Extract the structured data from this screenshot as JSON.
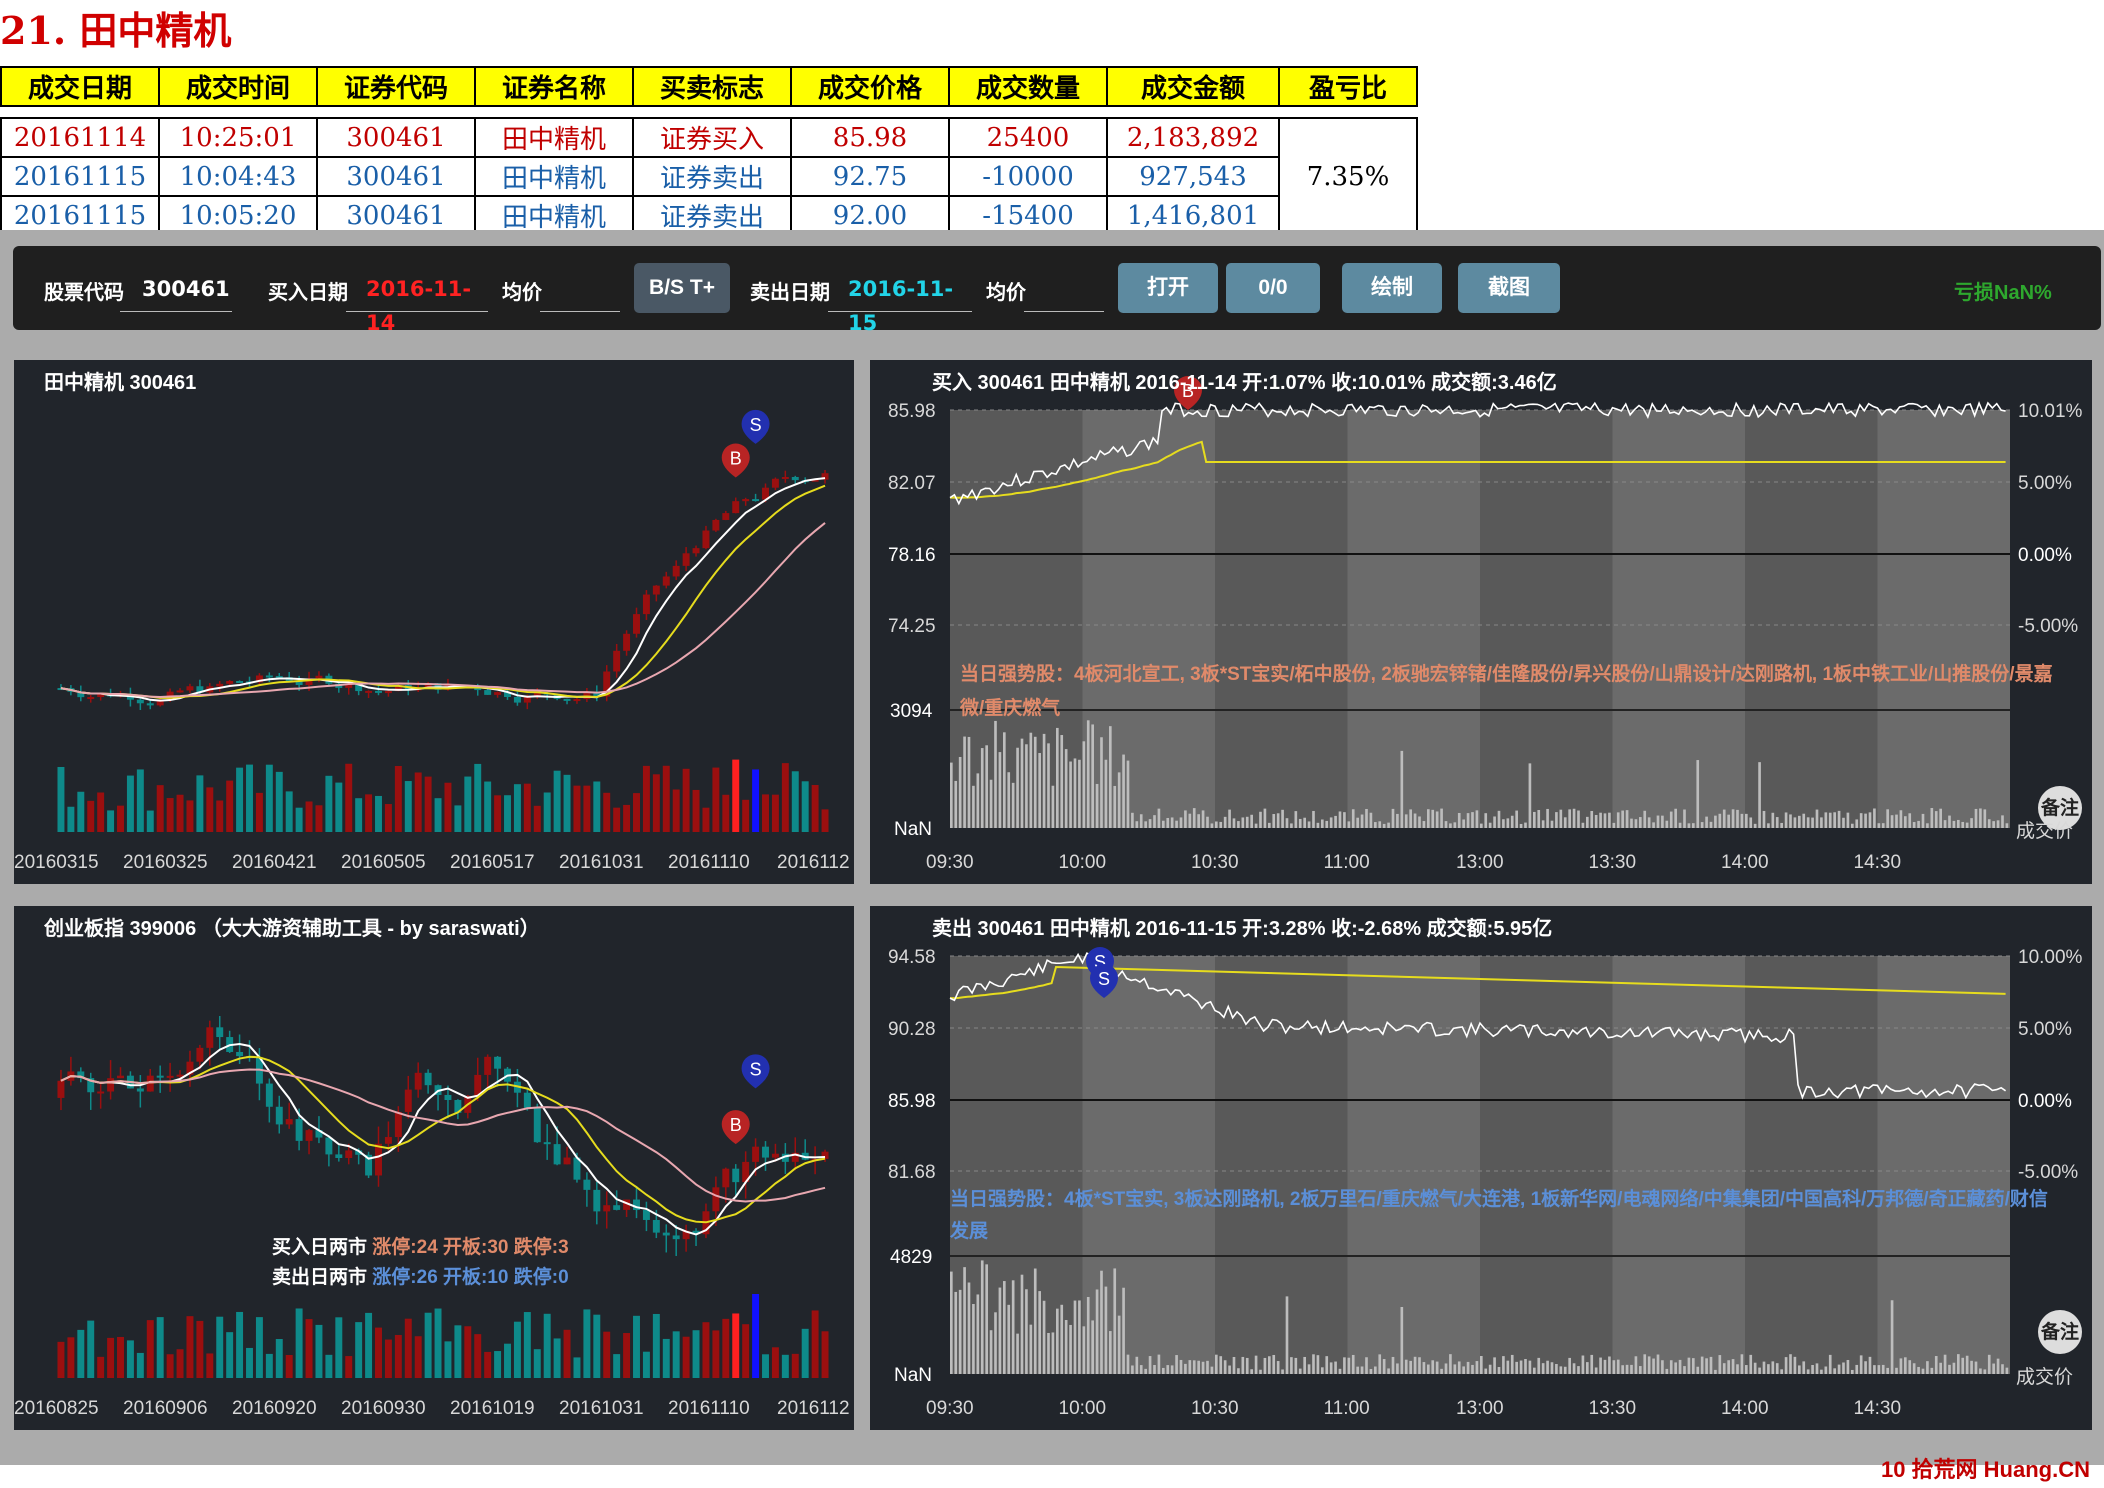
{
  "header": {
    "title": "21. 田中精机"
  },
  "trades_table": {
    "columns": [
      "成交日期",
      "成交时间",
      "证券代码",
      "证券名称",
      "买卖标志",
      "成交价格",
      "成交数量",
      "成交金额",
      "盈亏比"
    ],
    "rows": [
      [
        "20161114",
        "10:25:01",
        "300461",
        "田中精机",
        "证券买入",
        "85.98",
        "25400",
        "2,183,892"
      ],
      [
        "20161115",
        "10:04:43",
        "300461",
        "田中精机",
        "证券卖出",
        "92.75",
        "-10000",
        "927,543"
      ],
      [
        "20161115",
        "10:05:20",
        "300461",
        "田中精机",
        "证券卖出",
        "92.00",
        "-15400",
        "1,416,801"
      ]
    ],
    "pnl_ratio": "7.35%"
  },
  "toolbar": {
    "code_label": "股票代码",
    "code_value": "300461",
    "buy_date_label": "买入日期",
    "buy_date_value": "2016-11-14",
    "avg_label_1": "均价",
    "bs_button": "B/S T+",
    "sell_date_label": "卖出日期",
    "sell_date_value": "2016-11-15",
    "avg_label_2": "均价",
    "open_button": "打开",
    "counter_button": "0/0",
    "draw_button": "绘制",
    "screenshot_button": "截图",
    "status": "亏损NaN%"
  },
  "panels": {
    "stock_daily": {
      "title": "田中精机 300461",
      "dates": [
        "20160315",
        "20160325",
        "20160421",
        "20160505",
        "20160517",
        "20161031",
        "20161110",
        "2016112"
      ]
    },
    "index_daily": {
      "title": "创业板指 399006 （大大游资辅助工具 - by saraswati）",
      "dates": [
        "20160825",
        "20160906",
        "20160920",
        "20160930",
        "20161019",
        "20161031",
        "20161110",
        "2016112"
      ],
      "buy_market_label": "买入日两市",
      "buy_market_stats": "涨停:24 开板:30 跌停:3",
      "sell_market_label": "卖出日两市",
      "sell_market_stats": "涨停:26 开板:10 跌停:0"
    },
    "buy_intraday": {
      "title": "买入 300461 田中精机 2016-11-14 开:1.07% 收:10.01% 成交额:3.46亿",
      "price_ticks": [
        "85.98",
        "82.07",
        "78.16",
        "74.25"
      ],
      "pct_ticks": [
        "10.01%",
        "5.00%",
        "0.00%",
        "-5.00%"
      ],
      "vol_ticks": [
        "3094",
        "NaN"
      ],
      "times": [
        "09:30",
        "10:00",
        "10:30",
        "11:00",
        "13:00",
        "13:30",
        "14:00",
        "14:30"
      ],
      "strong": "当日强势股：4板河北宣工, 3板*ST宝实/柘中股份, 2板驰宏锌锗/佳隆股份/昇兴股份/山鼎设计/达刚路机, 1板中铁工业/山推股份/景嘉微/重庆燃气",
      "note_button": "备注",
      "price_label": "成交价"
    },
    "sell_intraday": {
      "title": "卖出 300461 田中精机 2016-11-15 开:3.28% 收:-2.68% 成交额:5.95亿",
      "price_ticks": [
        "94.58",
        "90.28",
        "85.98",
        "81.68"
      ],
      "pct_ticks": [
        "10.00%",
        "5.00%",
        "0.00%",
        "-5.00%"
      ],
      "vol_ticks": [
        "4829",
        "NaN"
      ],
      "times": [
        "09:30",
        "10:00",
        "10:30",
        "11:00",
        "13:00",
        "13:30",
        "14:00",
        "14:30"
      ],
      "strong": "当日强势股：4板*ST宝实, 3板达刚路机, 2板万里石/重庆燃气/大连港, 1板新华网/电魂网络/中集集团/中国高科/万邦德/奇正藏药/财信发展",
      "note_button": "备注",
      "price_label": "成交价"
    }
  },
  "markers": {
    "buy": "B",
    "sell": "S"
  },
  "colors": {
    "up": "#9b0f0f",
    "down": "#0e8a8a",
    "ma5": "#ffffff",
    "ma10": "#e6dc1e",
    "ma20": "#e8a7b0",
    "buy_marker": "#b82424",
    "sell_marker": "#2230b0",
    "strong_buy": "#e08a6a",
    "strong_sell": "#5b8fd8",
    "status": "#2ea82e"
  },
  "watermark": "10 拾荒网 Huang.CN"
}
